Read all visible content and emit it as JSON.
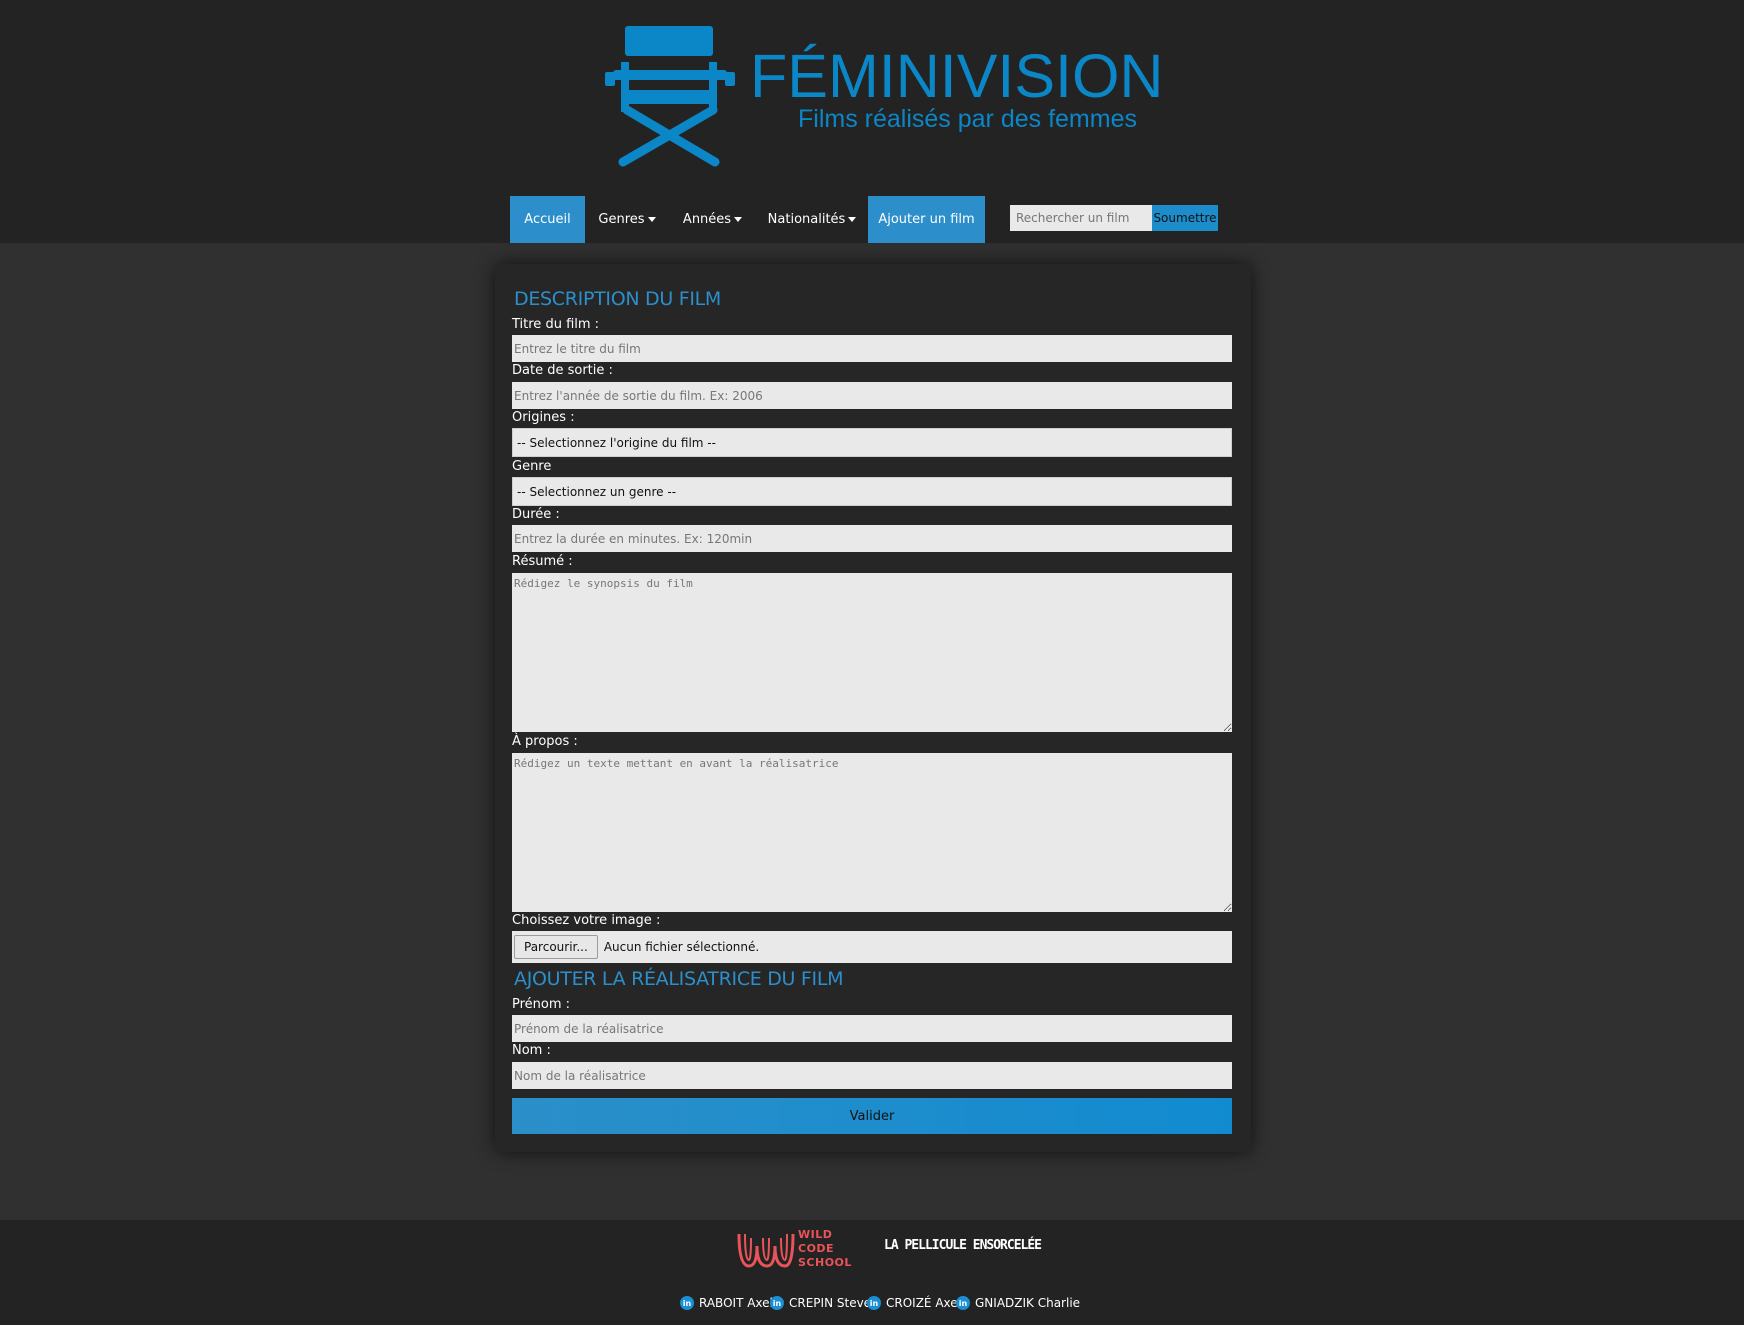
{
  "brand": {
    "title": "FÉMINIVISION",
    "subtitle": "Films réalisés par des femmes",
    "color": "#0b86c6"
  },
  "nav": {
    "items": [
      {
        "label": "Accueil",
        "active": true
      },
      {
        "label": "Genres",
        "dropdown": true
      },
      {
        "label": "Années",
        "dropdown": true
      },
      {
        "label": "Nationalités",
        "dropdown": true
      },
      {
        "label": "Ajouter un film",
        "active": true
      }
    ],
    "search_placeholder": "Rechercher un film",
    "search_button": "Soumettre"
  },
  "form": {
    "section1_title": "DESCRIPTION DU FILM",
    "title_label": "Titre du film :",
    "title_placeholder": "Entrez le titre du film",
    "date_label": "Date de sortie :",
    "date_placeholder": "Entrez l'année de sortie du film. Ex: 2006",
    "origin_label": "Origines :",
    "origin_value": "-- Selectionnez l'origine du film --",
    "genre_label": "Genre",
    "genre_value": "-- Selectionnez un genre --",
    "duration_label": "Durée :",
    "duration_placeholder": "Entrez la durée en minutes. Ex: 120min",
    "summary_label": "Résumé :",
    "summary_placeholder": "Rédigez le synopsis du film",
    "about_label": "À propos :",
    "about_placeholder": "Rédigez un texte mettant en avant la réalisatrice",
    "image_label": "Choissez votre image :",
    "file_button": "Parcourir...",
    "file_status": "Aucun fichier sélectionné.",
    "section2_title": "AJOUTER LA RÉALISATRICE DU FILM",
    "firstname_label": "Prénom :",
    "firstname_placeholder": "Prénom de la réalisatrice",
    "lastname_label": "Nom :",
    "lastname_placeholder": "Nom de la réalisatrice",
    "submit_label": "Valider"
  },
  "footer": {
    "wcs_lines": [
      "WILD",
      "CODE",
      "SCHOOL"
    ],
    "partner": "LA PELLICULE ENSORCELÉE",
    "linkedin_icon": "in",
    "credits": [
      "RABOIT Axel",
      "CREPIN Steve",
      "CROIZÉ Axel",
      "GNIADZIK Charlie"
    ]
  }
}
